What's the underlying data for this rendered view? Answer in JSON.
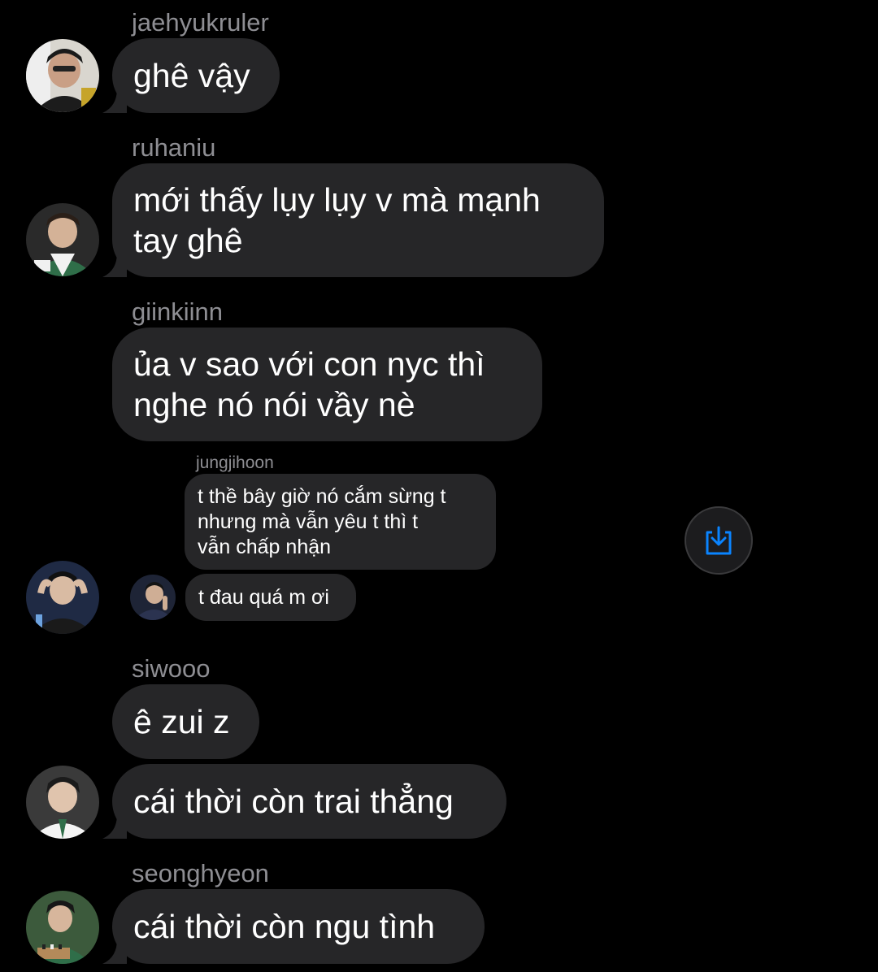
{
  "messages": [
    {
      "sender": "jaehyukruler",
      "text": "ghê vậy",
      "avatar_icon": "profile-photo"
    },
    {
      "sender": "ruhaniu",
      "text": "mới thấy lụy lụy v mà mạnh\ntay ghê",
      "avatar_icon": "profile-photo"
    },
    {
      "sender": "giinkiinn",
      "text": "ủa v sao với con nyc thì\nnghe nó nói vầy nè",
      "avatar_icon": "profile-photo"
    },
    {
      "sender": "siwooo",
      "text": "ê zui z",
      "text2": "cái thời còn trai thẳng",
      "avatar_icon": "profile-photo"
    },
    {
      "sender": "seonghyeon",
      "text": "cái thời còn ngu tình",
      "avatar_icon": "profile-photo"
    }
  ],
  "shared_post": {
    "sender": "jungjihoon",
    "text1": "t thề bây giờ nó cắm sừng t\nnhưng mà vẫn yêu t thì t\nvẫn chấp nhận",
    "text2": "t đau quá m ơi"
  },
  "share_button": {
    "icon": "download-share-icon",
    "accent": "#0a84ff"
  },
  "colors": {
    "background": "#000000",
    "bubble": "#262628",
    "sender_text": "#8e8e93"
  }
}
